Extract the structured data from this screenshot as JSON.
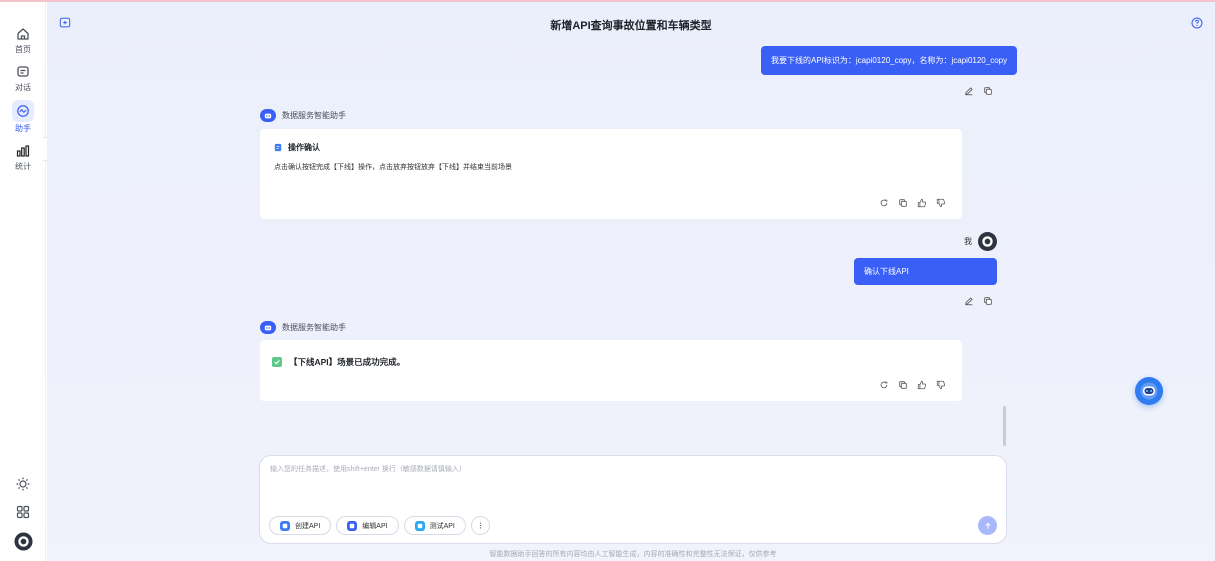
{
  "colors": {
    "accent": "#3a5ff6",
    "success": "#5fc88a",
    "page_bg": "#ebeffb"
  },
  "sidebar": {
    "items": [
      {
        "label": "首页",
        "icon": "home-icon",
        "active": false
      },
      {
        "label": "对话",
        "icon": "chat-icon",
        "active": false
      },
      {
        "label": "助手",
        "icon": "assistant-icon",
        "active": true
      },
      {
        "label": "统计",
        "icon": "stats-icon",
        "active": false
      }
    ],
    "bottom_icons": [
      "theme-sun-icon",
      "apps-grid-icon",
      "user-avatar"
    ]
  },
  "header": {
    "title": "新增API查询事故位置和车辆类型"
  },
  "conversation": {
    "user_message_1": "我要下线的API标识为：jcapi0120_copy，名称为：jcapi0120_copy",
    "assistant_name": "数据服务智能助手",
    "confirm_card": {
      "title": "操作确认",
      "text": "点击确认按钮完成【下线】操作，点击放弃按钮放弃【下线】并结束当前场景"
    },
    "me_label": "我",
    "user_message_2": "确认下线API",
    "result_card": {
      "text": "【下线API】场景已成功完成。"
    }
  },
  "input": {
    "placeholder": "输入您的任务描述，使用shift+enter 换行（敏感数据请慎输入）",
    "value": "",
    "quick_actions": [
      {
        "label": "创建API",
        "color": "#3a7bf6"
      },
      {
        "label": "编辑API",
        "color": "#3a5ff6"
      },
      {
        "label": "测试API",
        "color": "#26a8f2"
      }
    ]
  },
  "footer": {
    "disclaimer": "智能数据助手回答的所有内容均由人工智能生成，内容的准确性和完整性无法保证，仅供参考"
  }
}
